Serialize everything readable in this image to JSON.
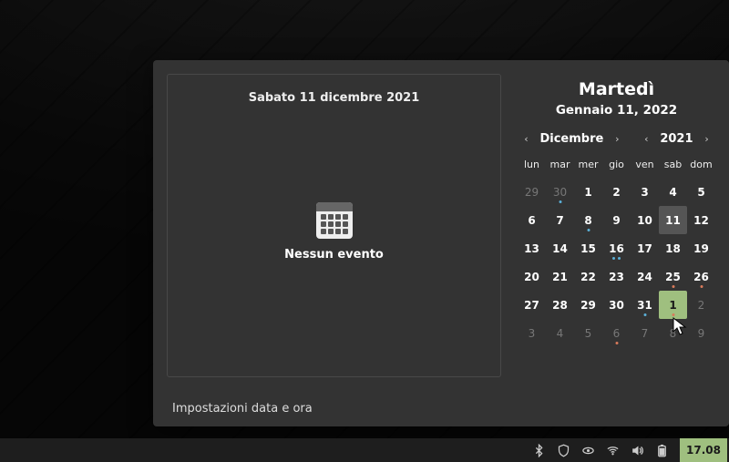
{
  "event_panel": {
    "date_heading": "Sabato 11 dicembre 2021",
    "empty_text": "Nessun evento"
  },
  "today": {
    "weekday": "Martedì",
    "full_date": "Gennaio 11, 2022"
  },
  "nav": {
    "month_label": "Dicembre",
    "year_label": "2021"
  },
  "dow": [
    "lun",
    "mar",
    "mer",
    "gio",
    "ven",
    "sab",
    "dom"
  ],
  "weeks": [
    [
      {
        "n": "29",
        "muted": true
      },
      {
        "n": "30",
        "muted": true,
        "dots": [
          {
            "c": "blue",
            "p": "center"
          }
        ]
      },
      {
        "n": "1"
      },
      {
        "n": "2"
      },
      {
        "n": "3"
      },
      {
        "n": "4"
      },
      {
        "n": "5"
      }
    ],
    [
      {
        "n": "6"
      },
      {
        "n": "7"
      },
      {
        "n": "8",
        "dots": [
          {
            "c": "blue",
            "p": "center"
          }
        ]
      },
      {
        "n": "9"
      },
      {
        "n": "10"
      },
      {
        "n": "11",
        "selected": true
      },
      {
        "n": "12"
      }
    ],
    [
      {
        "n": "13"
      },
      {
        "n": "14"
      },
      {
        "n": "15"
      },
      {
        "n": "16",
        "dots": [
          {
            "c": "blue",
            "p": "left"
          },
          {
            "c": "blue",
            "p": "right"
          }
        ]
      },
      {
        "n": "17"
      },
      {
        "n": "18"
      },
      {
        "n": "19"
      }
    ],
    [
      {
        "n": "20"
      },
      {
        "n": "21"
      },
      {
        "n": "22"
      },
      {
        "n": "23"
      },
      {
        "n": "24"
      },
      {
        "n": "25",
        "dots": [
          {
            "c": "red",
            "p": "center"
          }
        ]
      },
      {
        "n": "26",
        "dots": [
          {
            "c": "red",
            "p": "center"
          }
        ]
      }
    ],
    [
      {
        "n": "27"
      },
      {
        "n": "28"
      },
      {
        "n": "29"
      },
      {
        "n": "30"
      },
      {
        "n": "31",
        "dots": [
          {
            "c": "blue",
            "p": "center"
          }
        ]
      },
      {
        "n": "1",
        "today": true,
        "dots": [
          {
            "c": "red",
            "p": "center"
          }
        ]
      },
      {
        "n": "2",
        "muted": true
      }
    ],
    [
      {
        "n": "3",
        "muted": true
      },
      {
        "n": "4",
        "muted": true
      },
      {
        "n": "5",
        "muted": true
      },
      {
        "n": "6",
        "muted": true,
        "dots": [
          {
            "c": "red",
            "p": "center"
          }
        ]
      },
      {
        "n": "7",
        "muted": true
      },
      {
        "n": "8",
        "muted": true
      },
      {
        "n": "9",
        "muted": true
      }
    ]
  ],
  "settings_label": "Impostazioni data e ora",
  "taskbar": {
    "clock": "17.08"
  }
}
